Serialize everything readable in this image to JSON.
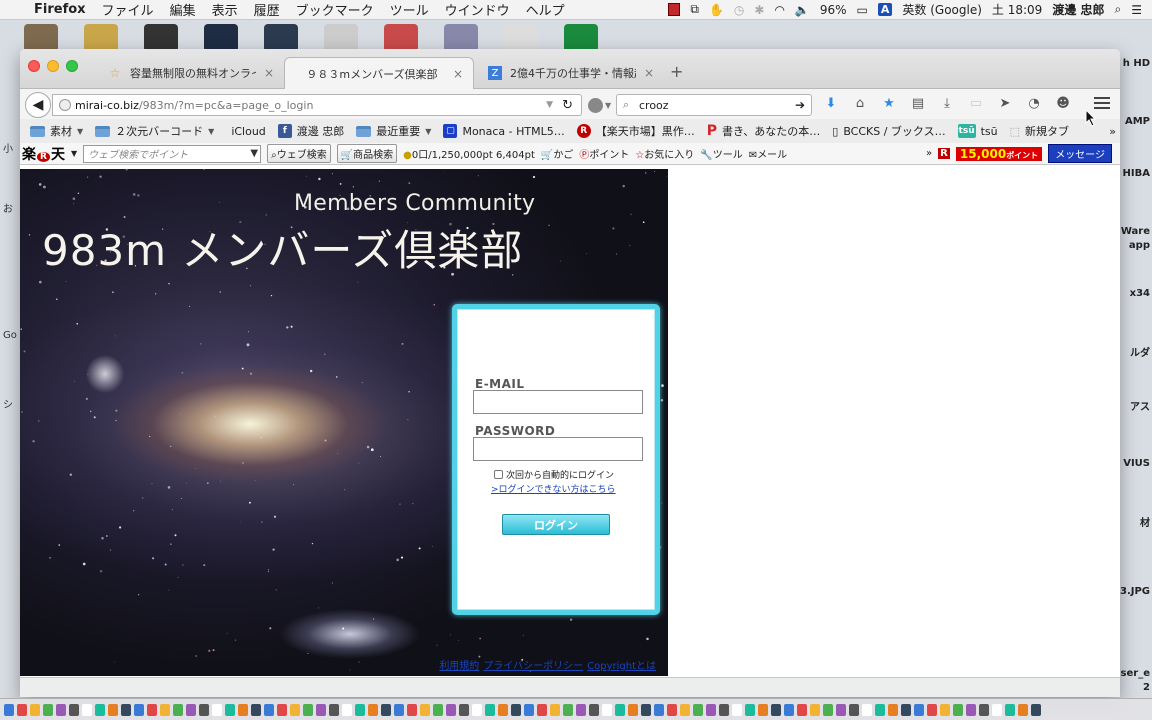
{
  "menubar": {
    "app_name": "Firefox",
    "items": [
      "ファイル",
      "編集",
      "表示",
      "履歴",
      "ブックマーク",
      "ツール",
      "ウインドウ",
      "ヘルプ"
    ],
    "battery": "96%",
    "input_method": "英数 (Google)",
    "input_badge": "A",
    "clock": "土 18:09",
    "user": "渡邊 忠郎"
  },
  "desktop": {
    "right_labels": [
      "h HD",
      "AMP",
      "HIBA",
      "Ware",
      "app",
      "x34",
      "ルダ",
      "アス",
      "VIUS",
      "材",
      "3.JPG",
      "ser_e",
      "2"
    ],
    "left_labels": [
      "小",
      "お",
      "Go",
      "シ"
    ]
  },
  "tabs": [
    {
      "label": "容量無制限の無料オンライ…",
      "icon": "star-icon",
      "active": false
    },
    {
      "label": "９８３mメンバーズ倶楽部",
      "icon": "",
      "active": true
    },
    {
      "label": "2億4千万の仕事学・情報起…",
      "icon": "z-icon",
      "active": false
    }
  ],
  "new_tab_label": "+",
  "close_glyph": "×",
  "url": {
    "host": "mirai-co.biz",
    "path": "/983m/?m=pc&a=page_o_login"
  },
  "search": {
    "value": "crooz"
  },
  "bookmarks": [
    {
      "label": "素材",
      "type": "folder",
      "dropdown": true
    },
    {
      "label": "２次元バーコード",
      "type": "folder",
      "dropdown": true
    },
    {
      "label": "iCloud",
      "type": "apple",
      "dropdown": false
    },
    {
      "label": "渡邊 忠郎",
      "type": "facebook",
      "dropdown": false
    },
    {
      "label": "最近重要",
      "type": "folder",
      "dropdown": true
    },
    {
      "label": "Monaca - HTML5…",
      "type": "monaca",
      "dropdown": false
    },
    {
      "label": "【楽天市場】黒作…",
      "type": "rakuten",
      "dropdown": false
    },
    {
      "label": "書き、あなたの本…",
      "type": "p",
      "dropdown": false
    },
    {
      "label": "BCCKS / ブックス…",
      "type": "page",
      "dropdown": false
    },
    {
      "label": "tsū",
      "type": "tsu",
      "dropdown": false
    },
    {
      "label": "新規タブ",
      "type": "blank",
      "dropdown": false
    }
  ],
  "rakuten_bar": {
    "logo_left": "楽",
    "logo_mid": "R",
    "logo_right": "天",
    "search_placeholder": "ウェブ検索でポイント",
    "web_search": "ウェブ検索",
    "product_search": "商品検索",
    "points": "0口/1,250,000pt 6,404pt",
    "cart": "かご",
    "point": "ポイント",
    "favorites": "お気に入り",
    "tools": "ツール",
    "mail": "メール",
    "promo": "15,000",
    "promo_suffix": "ポイント",
    "message": "メッセージ"
  },
  "page": {
    "subtitle": "Members Community",
    "title": "983m メンバーズ倶楽部",
    "login": {
      "email_label": "E-MAIL",
      "email_value": "",
      "password_label": "PASSWORD",
      "password_value": "",
      "remember_label": "次回から自動的にログイン",
      "forgot_link": ">ログインできない方はこちら",
      "submit": "ログイン"
    },
    "footer_links": [
      "利用規約",
      "プライバシーポリシー",
      "Copyrightとは"
    ]
  }
}
